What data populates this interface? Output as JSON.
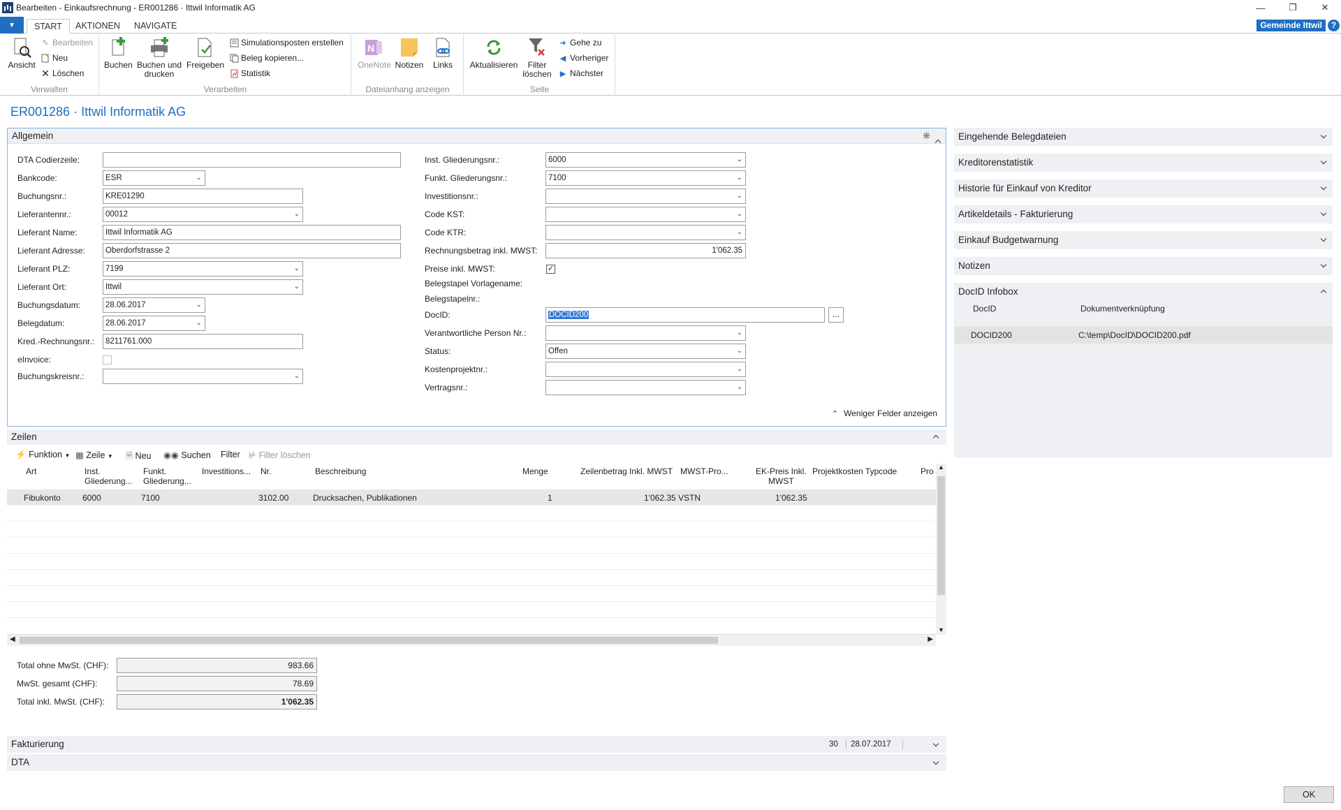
{
  "window": {
    "title": "Bearbeiten - Einkaufsrechnung - ER001286 · Ittwil Informatik AG"
  },
  "tabs": {
    "start": "START",
    "aktionen": "AKTIONEN",
    "navigate": "NAVIGATE"
  },
  "company": "Gemeinde Ittwil",
  "help_label": "?",
  "ribbon": {
    "verwalten": {
      "label": "Verwalten",
      "ansicht": "Ansicht",
      "bearbeiten": "Bearbeiten",
      "neu": "Neu",
      "loeschen": "Löschen"
    },
    "verarbeiten": {
      "label": "Verarbeiten",
      "buchen": "Buchen",
      "buchen_drucken_1": "Buchen und",
      "buchen_drucken_2": "drucken",
      "freigeben": "Freigeben",
      "simulation": "Simulationsposten erstellen",
      "beleg_kopieren": "Beleg kopieren...",
      "statistik": "Statistik"
    },
    "dateianhang": {
      "label": "Dateianhang anzeigen",
      "onenote": "OneNote",
      "notizen": "Notizen",
      "links": "Links"
    },
    "seite": {
      "label": "Seite",
      "aktualisieren": "Aktualisieren",
      "filter_1": "Filter",
      "filter_2": "löschen",
      "gehe_zu": "Gehe zu",
      "vorheriger": "Vorheriger",
      "naechster": "Nächster"
    }
  },
  "page_title": "ER001286 · Ittwil Informatik AG",
  "allgemein": {
    "title": "Allgemein",
    "left": [
      {
        "label": "DTA Codierzeile:",
        "value": ""
      },
      {
        "label": "Bankcode:",
        "value": "ESR"
      },
      {
        "label": "Buchungsnr.:",
        "value": "KRE01290"
      },
      {
        "label": "Lieferantennr.:",
        "value": "00012"
      },
      {
        "label": "Lieferant Name:",
        "value": "Ittwil Informatik AG"
      },
      {
        "label": "Lieferant Adresse:",
        "value": "Oberdorfstrasse 2"
      },
      {
        "label": "Lieferant PLZ:",
        "value": "7199"
      },
      {
        "label": "Lieferant Ort:",
        "value": "Ittwil"
      },
      {
        "label": "Buchungsdatum:",
        "value": "28.06.2017"
      },
      {
        "label": "Belegdatum:",
        "value": "28.06.2017"
      },
      {
        "label": "Kred.-Rechnungsnr.:",
        "value": "8211761.000"
      },
      {
        "label": "eInvoice:",
        "value": ""
      },
      {
        "label": "Buchungskreisnr.:",
        "value": ""
      }
    ],
    "right": [
      {
        "label": "Inst. Gliederungsnr.:",
        "value": "6000"
      },
      {
        "label": "Funkt. Gliederungsnr.:",
        "value": "7100"
      },
      {
        "label": "Investitionsnr.:",
        "value": ""
      },
      {
        "label": "Code KST:",
        "value": ""
      },
      {
        "label": "Code KTR:",
        "value": ""
      },
      {
        "label": "Rechnungsbetrag inkl. MWST:",
        "value": "1'062.35"
      },
      {
        "label": "Preise inkl. MWST:",
        "value": "✓"
      },
      {
        "label": "Belegstapel Vorlagename:",
        "value": ""
      },
      {
        "label": "Belegstapelnr.:",
        "value": ""
      },
      {
        "label": "DocID:",
        "value": "DOCID200"
      },
      {
        "label": "Verantwortliche Person Nr.:",
        "value": ""
      },
      {
        "label": "Status:",
        "value": "Offen"
      },
      {
        "label": "Kostenprojektnr.:",
        "value": ""
      },
      {
        "label": "Vertragsnr.:",
        "value": ""
      }
    ],
    "docid_button": "...",
    "weniger_felder": "Weniger Felder anzeigen"
  },
  "factboxes": [
    "Eingehende Belegdateien",
    "Kreditorenstatistik",
    "Historie für Einkauf von Kreditor",
    "Artikeldetails - Fakturierung",
    "Einkauf Budgetwarnung",
    "Notizen"
  ],
  "docid_infobox": {
    "title": "DocID Infobox",
    "col_docid": "DocID",
    "col_link": "Dokumentverknüpfung",
    "row_docid": "DOCID200",
    "row_link": "C:\\temp\\DocID\\DOCID200.pdf"
  },
  "zeilen": {
    "title": "Zeilen",
    "toolbar": {
      "funktion": "Funktion",
      "zeile": "Zeile",
      "neu": "Neu",
      "suchen": "Suchen",
      "filter": "Filter",
      "filter_loeschen": "Filter löschen"
    },
    "columns": [
      "Art",
      "Inst.\nGliederung...",
      "Funkt.\nGliederung...",
      "Investitions...",
      "Nr.",
      "Beschreibung",
      "Menge",
      "Zeilenbetrag Inkl. MWST",
      "MWST-Pro...",
      "EK-Preis Inkl.\nMWST",
      "Projektkosten Typcode",
      "Pro"
    ],
    "rows": [
      [
        "Fibukonto",
        "6000",
        "7100",
        "",
        "3102.00",
        "Drucksachen, Publikationen",
        "1",
        "1'062.35",
        "VSTN",
        "1'062.35",
        "",
        ""
      ]
    ]
  },
  "totals": [
    {
      "label": "Total ohne MwSt. (CHF):",
      "value": "983.66"
    },
    {
      "label": "MwSt. gesamt (CHF):",
      "value": "78.69"
    },
    {
      "label": "Total inkl. MwSt. (CHF):",
      "value": "1'062.35"
    }
  ],
  "fakturierung": {
    "title": "Fakturierung",
    "value1": "30",
    "value2": "28.07.2017"
  },
  "dta": {
    "title": "DTA"
  },
  "ok_button": "OK"
}
